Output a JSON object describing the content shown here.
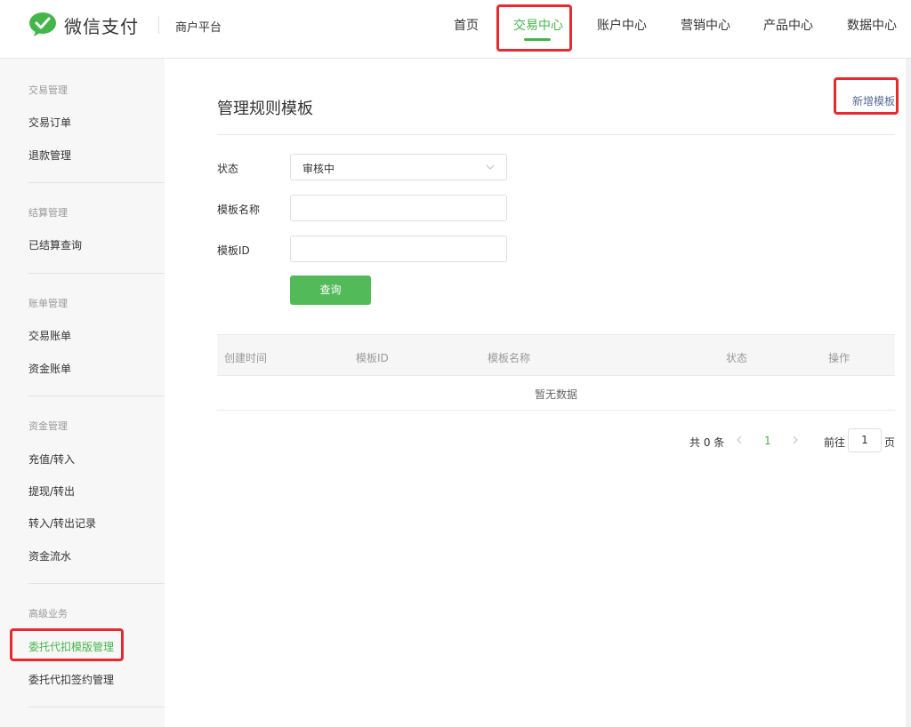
{
  "brand": {
    "name": "微信支付",
    "platform": "商户平台"
  },
  "nav": {
    "items": [
      {
        "label": "首页"
      },
      {
        "label": "交易中心"
      },
      {
        "label": "账户中心"
      },
      {
        "label": "营销中心"
      },
      {
        "label": "产品中心"
      },
      {
        "label": "数据中心"
      }
    ],
    "active_index": 1
  },
  "sidebar": {
    "groups": [
      {
        "title": "交易管理",
        "items": [
          "交易订单",
          "退款管理"
        ]
      },
      {
        "title": "结算管理",
        "items": [
          "已结算查询"
        ]
      },
      {
        "title": "账单管理",
        "items": [
          "交易账单",
          "资金账单"
        ]
      },
      {
        "title": "资金管理",
        "items": [
          "充值/转入",
          "提现/转出",
          "转入/转出记录",
          "资金流水"
        ]
      },
      {
        "title": "高级业务",
        "items": [
          "委托代扣模版管理",
          "委托代扣签约管理"
        ]
      }
    ],
    "active_item": "委托代扣模版管理"
  },
  "main": {
    "title": "管理规则模板",
    "new_button": "新增模板",
    "form": {
      "status_label": "状态",
      "status_value": "审核中",
      "name_label": "模板名称",
      "name_value": "",
      "id_label": "模板ID",
      "id_value": "",
      "query_button": "查询"
    },
    "table": {
      "columns": [
        "创建时间",
        "模板ID",
        "模板名称",
        "状态",
        "操作"
      ],
      "empty_text": "暂无数据"
    },
    "pagination": {
      "total_text": "共 0 条",
      "current_page": "1",
      "goto_label": "前往",
      "goto_value": "1",
      "goto_suffix": "页"
    }
  },
  "colors": {
    "accent": "#44b549",
    "link": "#576b95",
    "highlight": "#e8292f"
  }
}
